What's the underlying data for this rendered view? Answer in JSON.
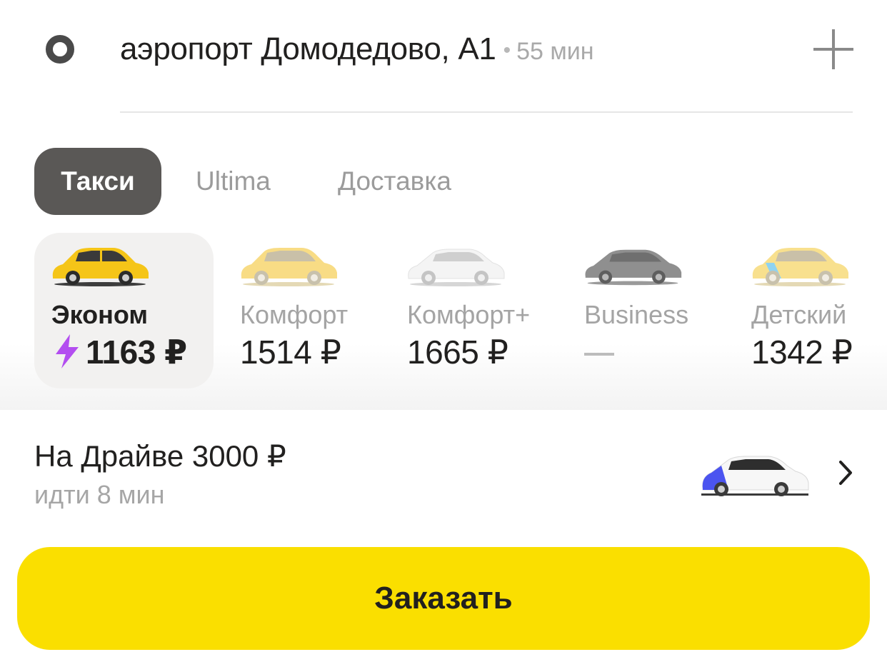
{
  "route": {
    "destination": "аэропорт Домодедово, А1",
    "separator": "•",
    "eta": "55 мин",
    "add_stop_icon": "plus-icon",
    "origin_icon": "ring-icon"
  },
  "tabs": [
    {
      "label": "Такси",
      "active": true
    },
    {
      "label": "Ultima",
      "active": false
    },
    {
      "label": "Доставка",
      "active": false
    }
  ],
  "tariffs": [
    {
      "name": "Эконом",
      "price": "1163 ₽",
      "selected": true,
      "surge_icon": "lightning-icon",
      "car_color": "#f5c518"
    },
    {
      "name": "Комфорт",
      "price": "1514 ₽",
      "selected": false,
      "car_color": "#f8dc85"
    },
    {
      "name": "Комфорт+",
      "price": "1665 ₽",
      "selected": false,
      "car_color": "#eeeeee"
    },
    {
      "name": "Business",
      "price": "—",
      "selected": false,
      "car_color": "#8f8f8f"
    },
    {
      "name": "Детский",
      "price": "1342 ₽",
      "selected": false,
      "car_color": "#f8e08e"
    }
  ],
  "promo": {
    "title": "На Драйве 3000 ₽",
    "subtitle": "идти 8 мин",
    "car_accent": "#4b54f0",
    "chevron_icon": "chevron-right-icon"
  },
  "order_button": {
    "label": "Заказать",
    "color": "#fadf00"
  },
  "colors": {
    "accent": "#fadf00",
    "active_tab": "#5a5856",
    "surge": "#b34ef0"
  }
}
